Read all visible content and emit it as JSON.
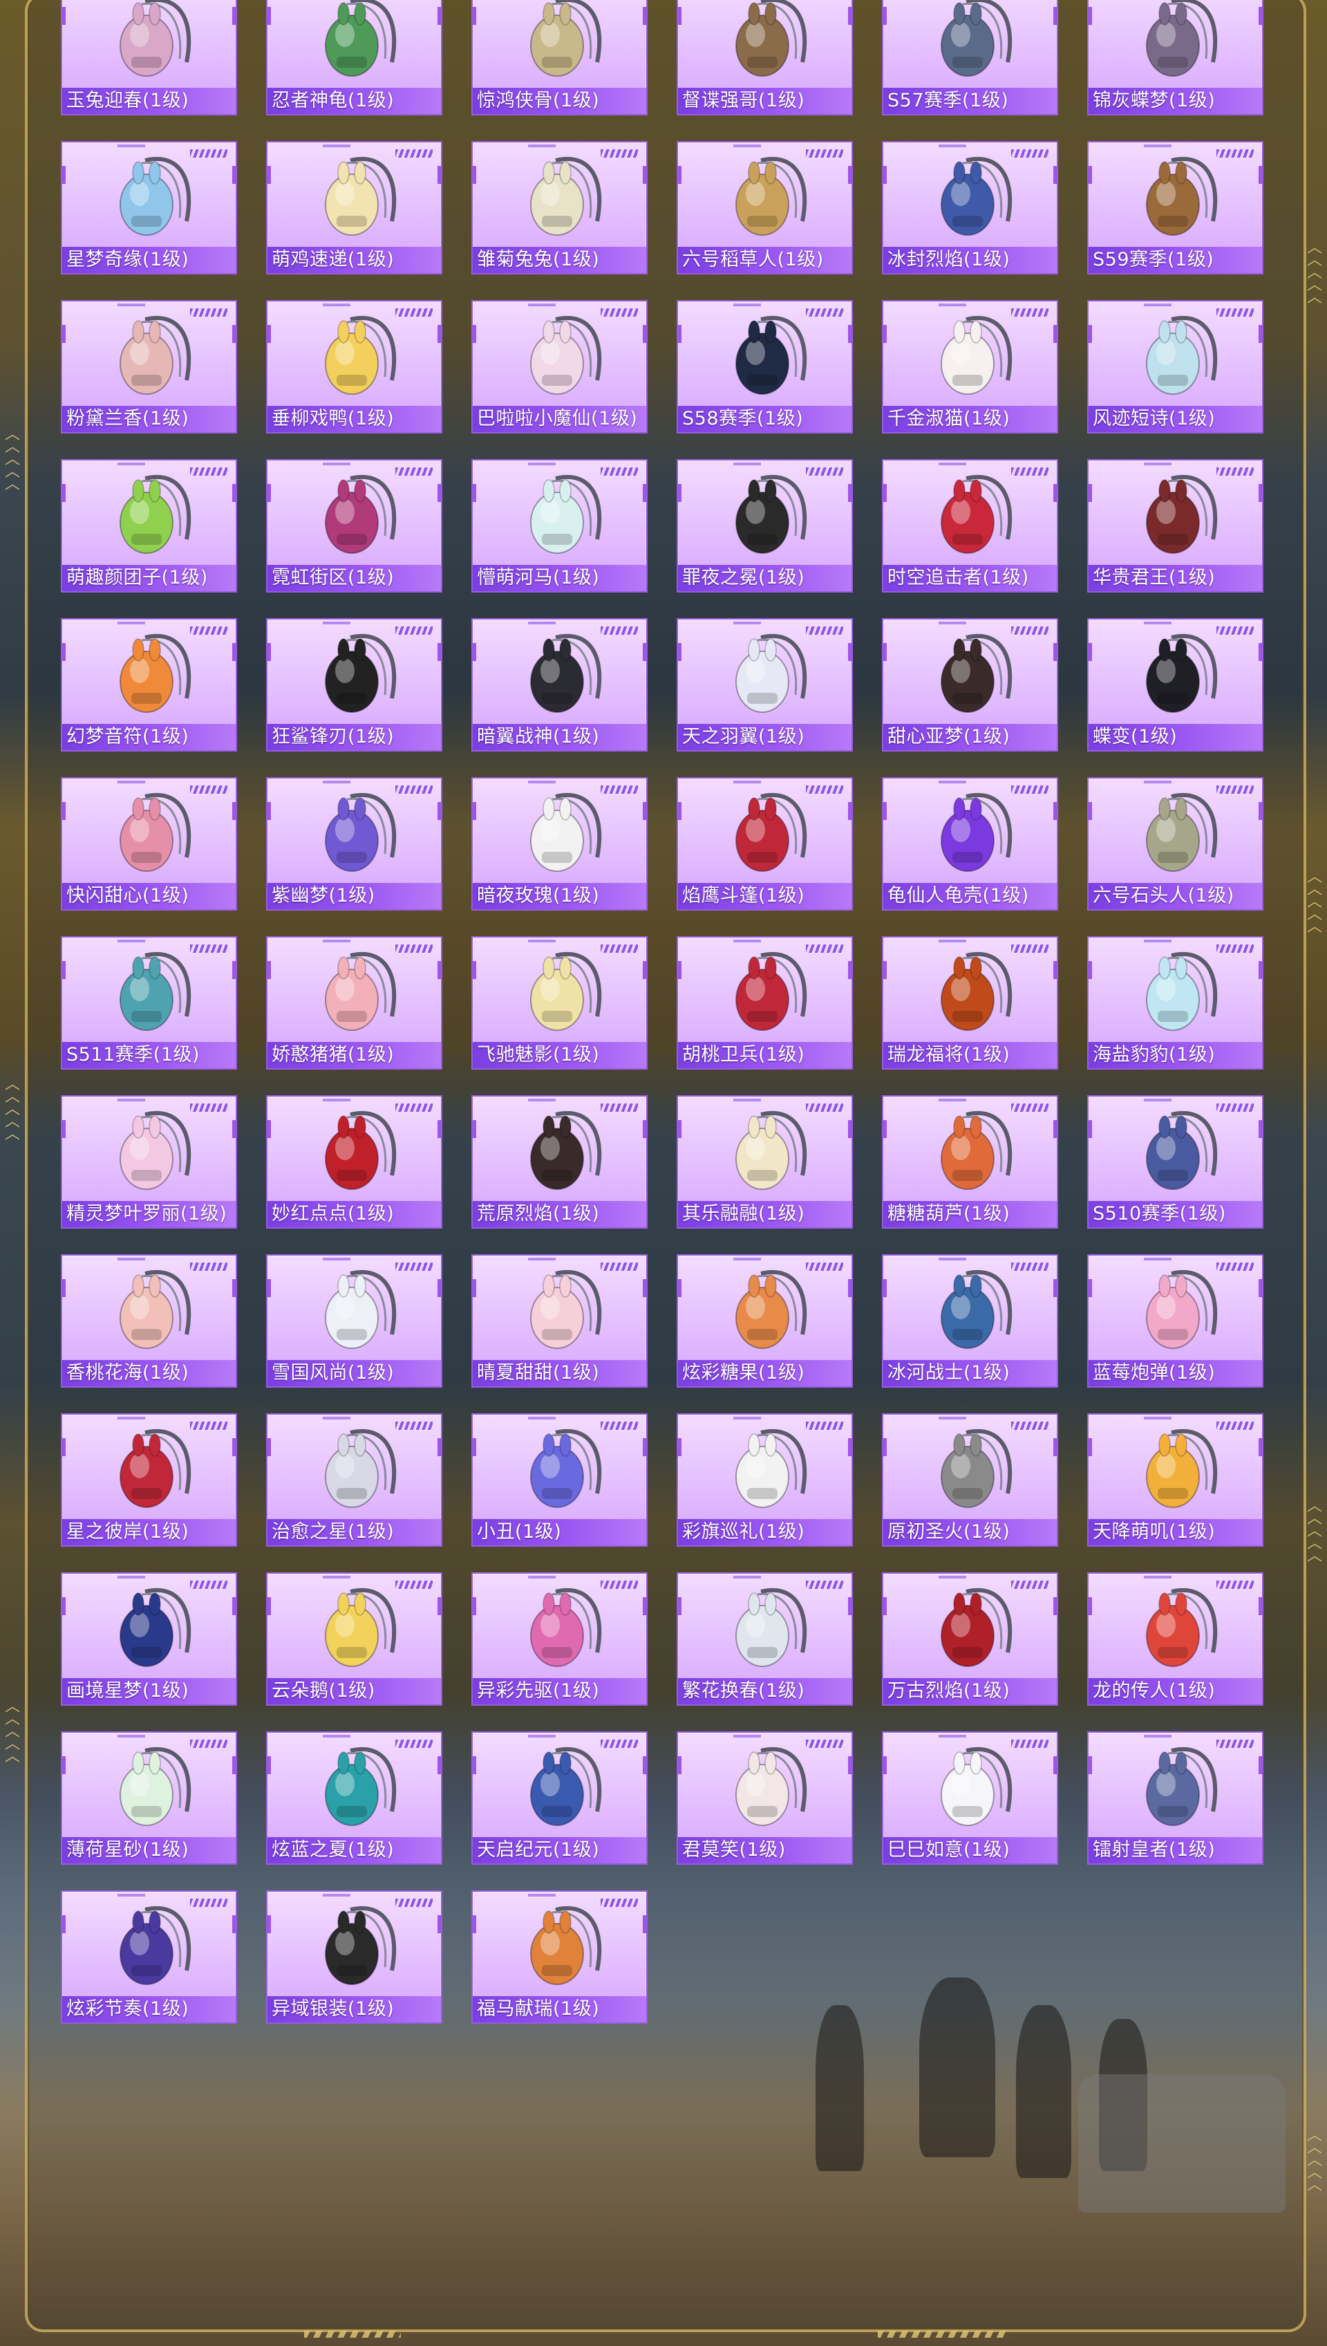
{
  "items": [
    {
      "name": "玉兔迎春(1级)",
      "icon": "backpack-icon",
      "color": "#d9a7c7"
    },
    {
      "name": "忍者神龟(1级)",
      "icon": "backpack-icon",
      "color": "#4e9a59"
    },
    {
      "name": "惊鸿侠骨(1级)",
      "icon": "backpack-icon",
      "color": "#c9b88a"
    },
    {
      "name": "督谍强哥(1级)",
      "icon": "backpack-icon",
      "color": "#8a6b4a"
    },
    {
      "name": "S57赛季(1级)",
      "icon": "backpack-icon",
      "color": "#5a6b8a"
    },
    {
      "name": "锦灰蝶梦(1级)",
      "icon": "backpack-icon",
      "color": "#7a6a8a"
    },
    {
      "name": "星梦奇缘(1级)",
      "icon": "swan-backpack-icon",
      "color": "#8fc6ea"
    },
    {
      "name": "萌鸡速递(1级)",
      "icon": "chick-backpack-icon",
      "color": "#f3e3b0"
    },
    {
      "name": "雏菊兔兔(1级)",
      "icon": "bunny-backpack-icon",
      "color": "#e7e2c8"
    },
    {
      "name": "六号稻草人(1级)",
      "icon": "scarecrow-backpack-icon",
      "color": "#c9a15a"
    },
    {
      "name": "冰封烈焰(1级)",
      "icon": "backpack-icon",
      "color": "#3f5aa8"
    },
    {
      "name": "S59赛季(1级)",
      "icon": "backpack-icon",
      "color": "#9b6a3a"
    },
    {
      "name": "粉黛兰香(1级)",
      "icon": "bunny-backpack-icon",
      "color": "#e6b8b5"
    },
    {
      "name": "垂柳戏鸭(1级)",
      "icon": "bunny-backpack-icon",
      "color": "#f3cf5c"
    },
    {
      "name": "巴啦啦小魔仙(1级)",
      "icon": "bunny-backpack-icon",
      "color": "#f2d9e8"
    },
    {
      "name": "S58赛季(1级)",
      "icon": "backpack-icon",
      "color": "#1f2a44"
    },
    {
      "name": "千金淑猫(1级)",
      "icon": "cat-backpack-icon",
      "color": "#f6f0f0"
    },
    {
      "name": "风迹短诗(1级)",
      "icon": "backpack-icon",
      "color": "#bfe1ee"
    },
    {
      "name": "萌趣颜团子(1级)",
      "icon": "radish-backpack-icon",
      "color": "#8fd14f"
    },
    {
      "name": "霓虹街区(1级)",
      "icon": "backpack-icon",
      "color": "#b03a7a"
    },
    {
      "name": "懵萌河马(1级)",
      "icon": "hippo-backpack-icon",
      "color": "#d9f0f0"
    },
    {
      "name": "罪夜之冕(1级)",
      "icon": "backpack-icon",
      "color": "#2a2a2a"
    },
    {
      "name": "时空追击者(1级)",
      "icon": "backpack-icon",
      "color": "#c9283a"
    },
    {
      "name": "华贵君王(1级)",
      "icon": "backpack-icon",
      "color": "#7a2a2a"
    },
    {
      "name": "幻梦音符(1级)",
      "icon": "rocket-backpack-icon",
      "color": "#f08a3a"
    },
    {
      "name": "狂鲨锋刃(1级)",
      "icon": "backpack-icon",
      "color": "#222222"
    },
    {
      "name": "暗翼战神(1级)",
      "icon": "backpack-icon",
      "color": "#2b2b33"
    },
    {
      "name": "天之羽翼(1级)",
      "icon": "backpack-icon",
      "color": "#e6e9f5"
    },
    {
      "name": "甜心亚梦(1级)",
      "icon": "backpack-icon",
      "color": "#3a2a2a"
    },
    {
      "name": "蝶变(1级)",
      "icon": "backpack-icon",
      "color": "#1f1f26"
    },
    {
      "name": "快闪甜心(1级)",
      "icon": "camera-backpack-icon",
      "color": "#e58fa8"
    },
    {
      "name": "紫幽梦(1级)",
      "icon": "bunny-backpack-icon",
      "color": "#6f5ad3"
    },
    {
      "name": "暗夜玫瑰(1级)",
      "icon": "bunny-backpack-icon",
      "color": "#f2f2f2"
    },
    {
      "name": "焰鹰斗篷(1级)",
      "icon": "backpack-icon",
      "color": "#c0283a"
    },
    {
      "name": "龟仙人龟壳(1级)",
      "icon": "backpack-icon",
      "color": "#7a3ae0"
    },
    {
      "name": "六号石头人(1级)",
      "icon": "backpack-icon",
      "color": "#a6a68a"
    },
    {
      "name": "S511赛季(1级)",
      "icon": "backpack-icon",
      "color": "#4fa3b0"
    },
    {
      "name": "娇憨猪猪(1级)",
      "icon": "pig-backpack-icon",
      "color": "#f2b0b8"
    },
    {
      "name": "飞驰魅影(1级)",
      "icon": "bunny-backpack-icon",
      "color": "#f0e2a6"
    },
    {
      "name": "胡桃卫兵(1级)",
      "icon": "backpack-icon",
      "color": "#c0283a"
    },
    {
      "name": "瑞龙福将(1级)",
      "icon": "backpack-icon",
      "color": "#c04a1a"
    },
    {
      "name": "海盐豹豹(1级)",
      "icon": "backpack-icon",
      "color": "#bfe6f2"
    },
    {
      "name": "精灵梦叶罗丽(1级)",
      "icon": "heart-backpack-icon",
      "color": "#f2c8e2"
    },
    {
      "name": "妙红点点(1级)",
      "icon": "backpack-icon",
      "color": "#c0202a"
    },
    {
      "name": "荒原烈焰(1级)",
      "icon": "backpack-icon",
      "color": "#3a2a2a"
    },
    {
      "name": "其乐融融(1级)",
      "icon": "backpack-icon",
      "color": "#f2e6c8"
    },
    {
      "name": "糖糖葫芦(1级)",
      "icon": "fox-backpack-icon",
      "color": "#e06a3a"
    },
    {
      "name": "S510赛季(1级)",
      "icon": "backpack-icon",
      "color": "#4a5aa0"
    },
    {
      "name": "香桃花海(1级)",
      "icon": "shell-backpack-icon",
      "color": "#f2c0b8"
    },
    {
      "name": "雪国风尚(1级)",
      "icon": "bunny-backpack-icon",
      "color": "#eef0f8"
    },
    {
      "name": "晴夏甜甜(1级)",
      "icon": "bunny-backpack-icon",
      "color": "#f6d0d8"
    },
    {
      "name": "炫彩糖果(1级)",
      "icon": "donut-backpack-icon",
      "color": "#e78a4a"
    },
    {
      "name": "冰河战士(1级)",
      "icon": "backpack-icon",
      "color": "#3a6aa8"
    },
    {
      "name": "蓝莓炮弹(1级)",
      "icon": "backpack-icon",
      "color": "#f2a8c8"
    },
    {
      "name": "星之彼岸(1级)",
      "icon": "helmet-backpack-icon",
      "color": "#c0283a"
    },
    {
      "name": "治愈之星(1级)",
      "icon": "backpack-icon",
      "color": "#d8d8e6"
    },
    {
      "name": "小丑(1级)",
      "icon": "backpack-icon",
      "color": "#6a6ae0"
    },
    {
      "name": "彩旗巡礼(1级)",
      "icon": "backpack-icon",
      "color": "#f2f2f2"
    },
    {
      "name": "原初圣火(1级)",
      "icon": "backpack-icon",
      "color": "#8a8a8a"
    },
    {
      "name": "天降萌叽(1级)",
      "icon": "backpack-icon",
      "color": "#f2b03a"
    },
    {
      "name": "画境星梦(1级)",
      "icon": "backpack-icon",
      "color": "#2a3a8a"
    },
    {
      "name": "云朵鹅(1级)",
      "icon": "flower-backpack-icon",
      "color": "#f2d25a"
    },
    {
      "name": "异彩先驱(1级)",
      "icon": "backpack-icon",
      "color": "#e06ab0"
    },
    {
      "name": "繁花换春(1级)",
      "icon": "backpack-icon",
      "color": "#dfe6ee"
    },
    {
      "name": "万古烈焰(1级)",
      "icon": "backpack-icon",
      "color": "#b02028"
    },
    {
      "name": "龙的传人(1级)",
      "icon": "backpack-icon",
      "color": "#e0453a"
    },
    {
      "name": "薄荷星砂(1级)",
      "icon": "backpack-icon",
      "color": "#dff2e0"
    },
    {
      "name": "炫蓝之夏(1级)",
      "icon": "backpack-icon",
      "color": "#2aa0a8"
    },
    {
      "name": "天启纪元(1级)",
      "icon": "backpack-icon",
      "color": "#3a5ab0"
    },
    {
      "name": "君莫笑(1级)",
      "icon": "backpack-icon",
      "color": "#f2e6e6"
    },
    {
      "name": "巳巳如意(1级)",
      "icon": "bunny-backpack-icon",
      "color": "#f6f6fa"
    },
    {
      "name": "镭射皇者(1级)",
      "icon": "backpack-icon",
      "color": "#5a6aa0"
    },
    {
      "name": "炫彩节奏(1级)",
      "icon": "backpack-icon",
      "color": "#4a3aa0"
    },
    {
      "name": "异域银装(1级)",
      "icon": "backpack-icon",
      "color": "#2a2a2a"
    },
    {
      "name": "福马献瑞(1级)",
      "icon": "backpack-icon",
      "color": "#e0823a"
    }
  ]
}
